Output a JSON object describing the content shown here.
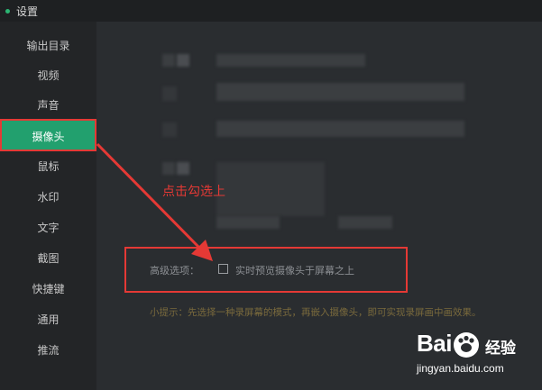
{
  "window": {
    "title": "设置"
  },
  "sidebar": {
    "items": [
      {
        "label": "输出目录",
        "active": false
      },
      {
        "label": "视频",
        "active": false
      },
      {
        "label": "声音",
        "active": false
      },
      {
        "label": "摄像头",
        "active": true
      },
      {
        "label": "鼠标",
        "active": false
      },
      {
        "label": "水印",
        "active": false
      },
      {
        "label": "文字",
        "active": false
      },
      {
        "label": "截图",
        "active": false
      },
      {
        "label": "快捷键",
        "active": false
      },
      {
        "label": "通用",
        "active": false
      },
      {
        "label": "推流",
        "active": false
      }
    ]
  },
  "main": {
    "advanced_label": "高级选项：",
    "overlay_option_label": "实时预览摄像头于屏幕之上",
    "overlay_option_checked": false,
    "tip": "小提示：先选择一种录屏幕的模式，再嵌入摄像头，即可实现录屏画中画效果。"
  },
  "annotation": {
    "text": "点击勾选上",
    "color": "#e53935"
  },
  "watermark": {
    "logo_text": "Bai",
    "logo_suffix": "经验",
    "url": "jingyan.baidu.com"
  },
  "colors": {
    "accent": "#22a06e",
    "annotation": "#e53935"
  }
}
